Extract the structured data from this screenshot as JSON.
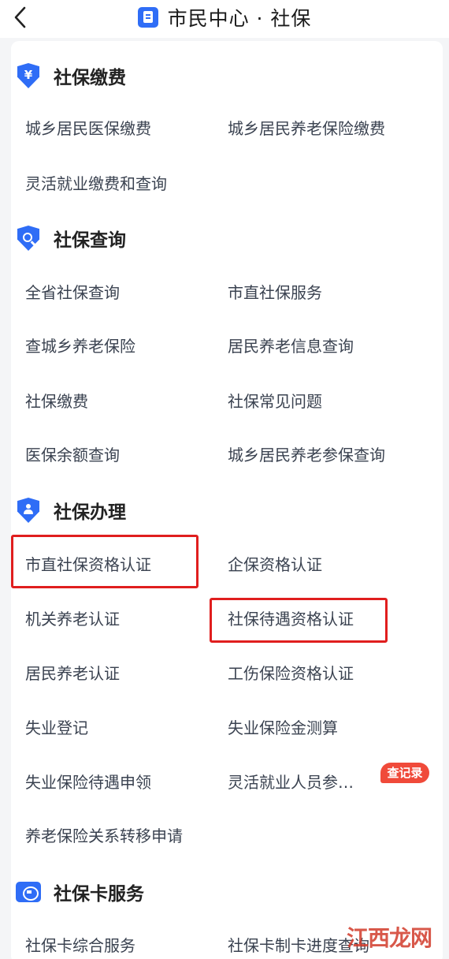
{
  "header": {
    "title": "市民中心 · 社保"
  },
  "sections": [
    {
      "title": "社保缴费",
      "icon": "yuan-shield-icon",
      "glyph": "¥",
      "items": [
        "城乡居民医保缴费",
        "城乡居民养老保险缴费",
        "灵活就业缴费和查询"
      ]
    },
    {
      "title": "社保查询",
      "icon": "search-shield-icon",
      "items": [
        "全省社保查询",
        "市直社保服务",
        "查城乡养老保险",
        "居民养老信息查询",
        "社保缴费",
        "社保常见问题",
        "医保余额查询",
        "城乡居民养老参保查询"
      ]
    },
    {
      "title": "社保办理",
      "icon": "person-shield-icon",
      "items": [
        "市直社保资格认证",
        "企保资格认证",
        "机关养老认证",
        "社保待遇资格认证",
        "居民养老认证",
        "工伤保险资格认证",
        "失业登记",
        "失业保险金测算",
        "失业保险待遇申领",
        "灵活就业人员参…",
        "养老保险关系转移申请"
      ]
    },
    {
      "title": "社保卡服务",
      "icon": "social-card-icon",
      "items": [
        "社保卡综合服务",
        "社保卡制卡进度查询"
      ]
    }
  ],
  "badge": "查记录",
  "watermark": "江西龙网",
  "colors": {
    "accent": "#2f6df6",
    "highlight": "#e01e1e",
    "badge": "#f04a3a"
  }
}
